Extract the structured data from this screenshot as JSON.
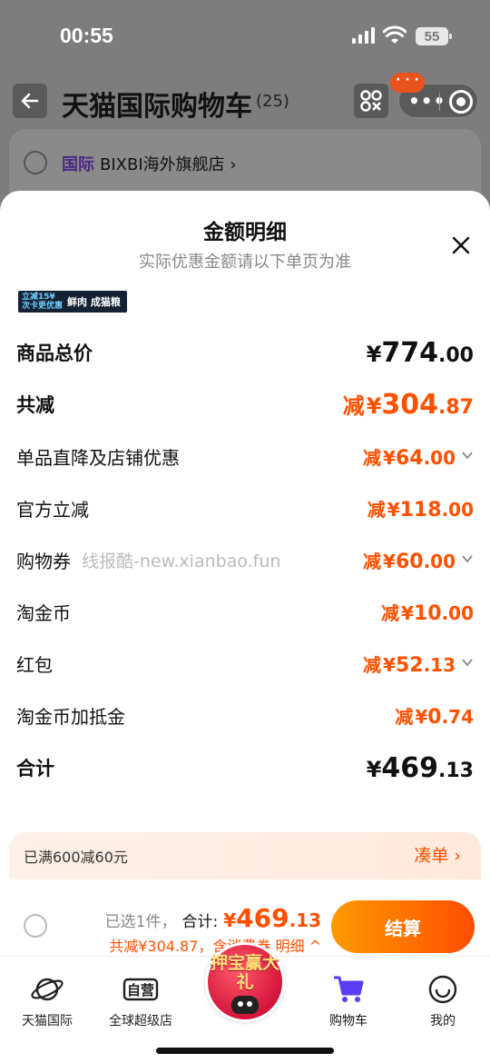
{
  "status_bar": {
    "time": "00:55",
    "battery": "55"
  },
  "header": {
    "title": "天猫国际购物车",
    "count": "(25)",
    "notif_badge": "· · ·",
    "more_icon": "more-dots-icon",
    "target_icon": "target-icon"
  },
  "store": {
    "tag": "国际",
    "name": "BIXBI海外旗舰店 ›"
  },
  "sheet": {
    "title": "金额明细",
    "subtitle": "实际优惠金额请以下单页为准",
    "promo_left": "立减15¥ 次卡更优惠",
    "promo_right": "鲜肉 成猫粮",
    "watermark": "线报酷-new.xianbao.fun",
    "rows": [
      {
        "label": "商品总价",
        "prefix": "",
        "yen": "¥",
        "int": "774",
        "dec": ".00"
      },
      {
        "label": "共减",
        "prefix": "减",
        "yen": "¥",
        "int": "304",
        "dec": ".87"
      },
      {
        "label": "单品直降及店铺优惠",
        "prefix": "减",
        "yen": "¥",
        "int": "64",
        "dec": ".00"
      },
      {
        "label": "官方立减",
        "prefix": "减",
        "yen": "¥",
        "int": "118",
        "dec": ".00"
      },
      {
        "label": "购物券",
        "prefix": "减",
        "yen": "¥",
        "int": "60",
        "dec": ".00"
      },
      {
        "label": "淘金币",
        "prefix": "减",
        "yen": "¥",
        "int": "10",
        "dec": ".00"
      },
      {
        "label": "红包",
        "prefix": "减",
        "yen": "¥",
        "int": "52",
        "dec": ".13"
      },
      {
        "label": "淘金币加抵金",
        "prefix": "减",
        "yen": "¥",
        "int": "0",
        "dec": ".74"
      },
      {
        "label": "合计",
        "prefix": "",
        "yen": "¥",
        "int": "469",
        "dec": ".13"
      }
    ]
  },
  "promo_bar": {
    "left": "已满600减60元",
    "right": "凑单 ›"
  },
  "checkout": {
    "selected": "已选1件，",
    "total_label": "合计:",
    "yen": "¥",
    "int": "469",
    "dec": ".13",
    "discount": "共减¥304.87，含消费券 明细 ^",
    "pay_label": "结算"
  },
  "tabs": [
    {
      "label": "天猫国际",
      "icon": "planet-icon"
    },
    {
      "label": "全球超级店",
      "icon": "self-operated-icon"
    },
    {
      "label": "购物车",
      "icon": "cart-icon"
    },
    {
      "label": "我的",
      "icon": "smiley-icon"
    }
  ],
  "center_promo": {
    "text": "押宝赢大礼"
  },
  "colors": {
    "accent": "#ff5000",
    "pay_gradient_start": "#ff9a00",
    "pay_gradient_end": "#ff4d00",
    "overlay": "#7d7d7d"
  }
}
